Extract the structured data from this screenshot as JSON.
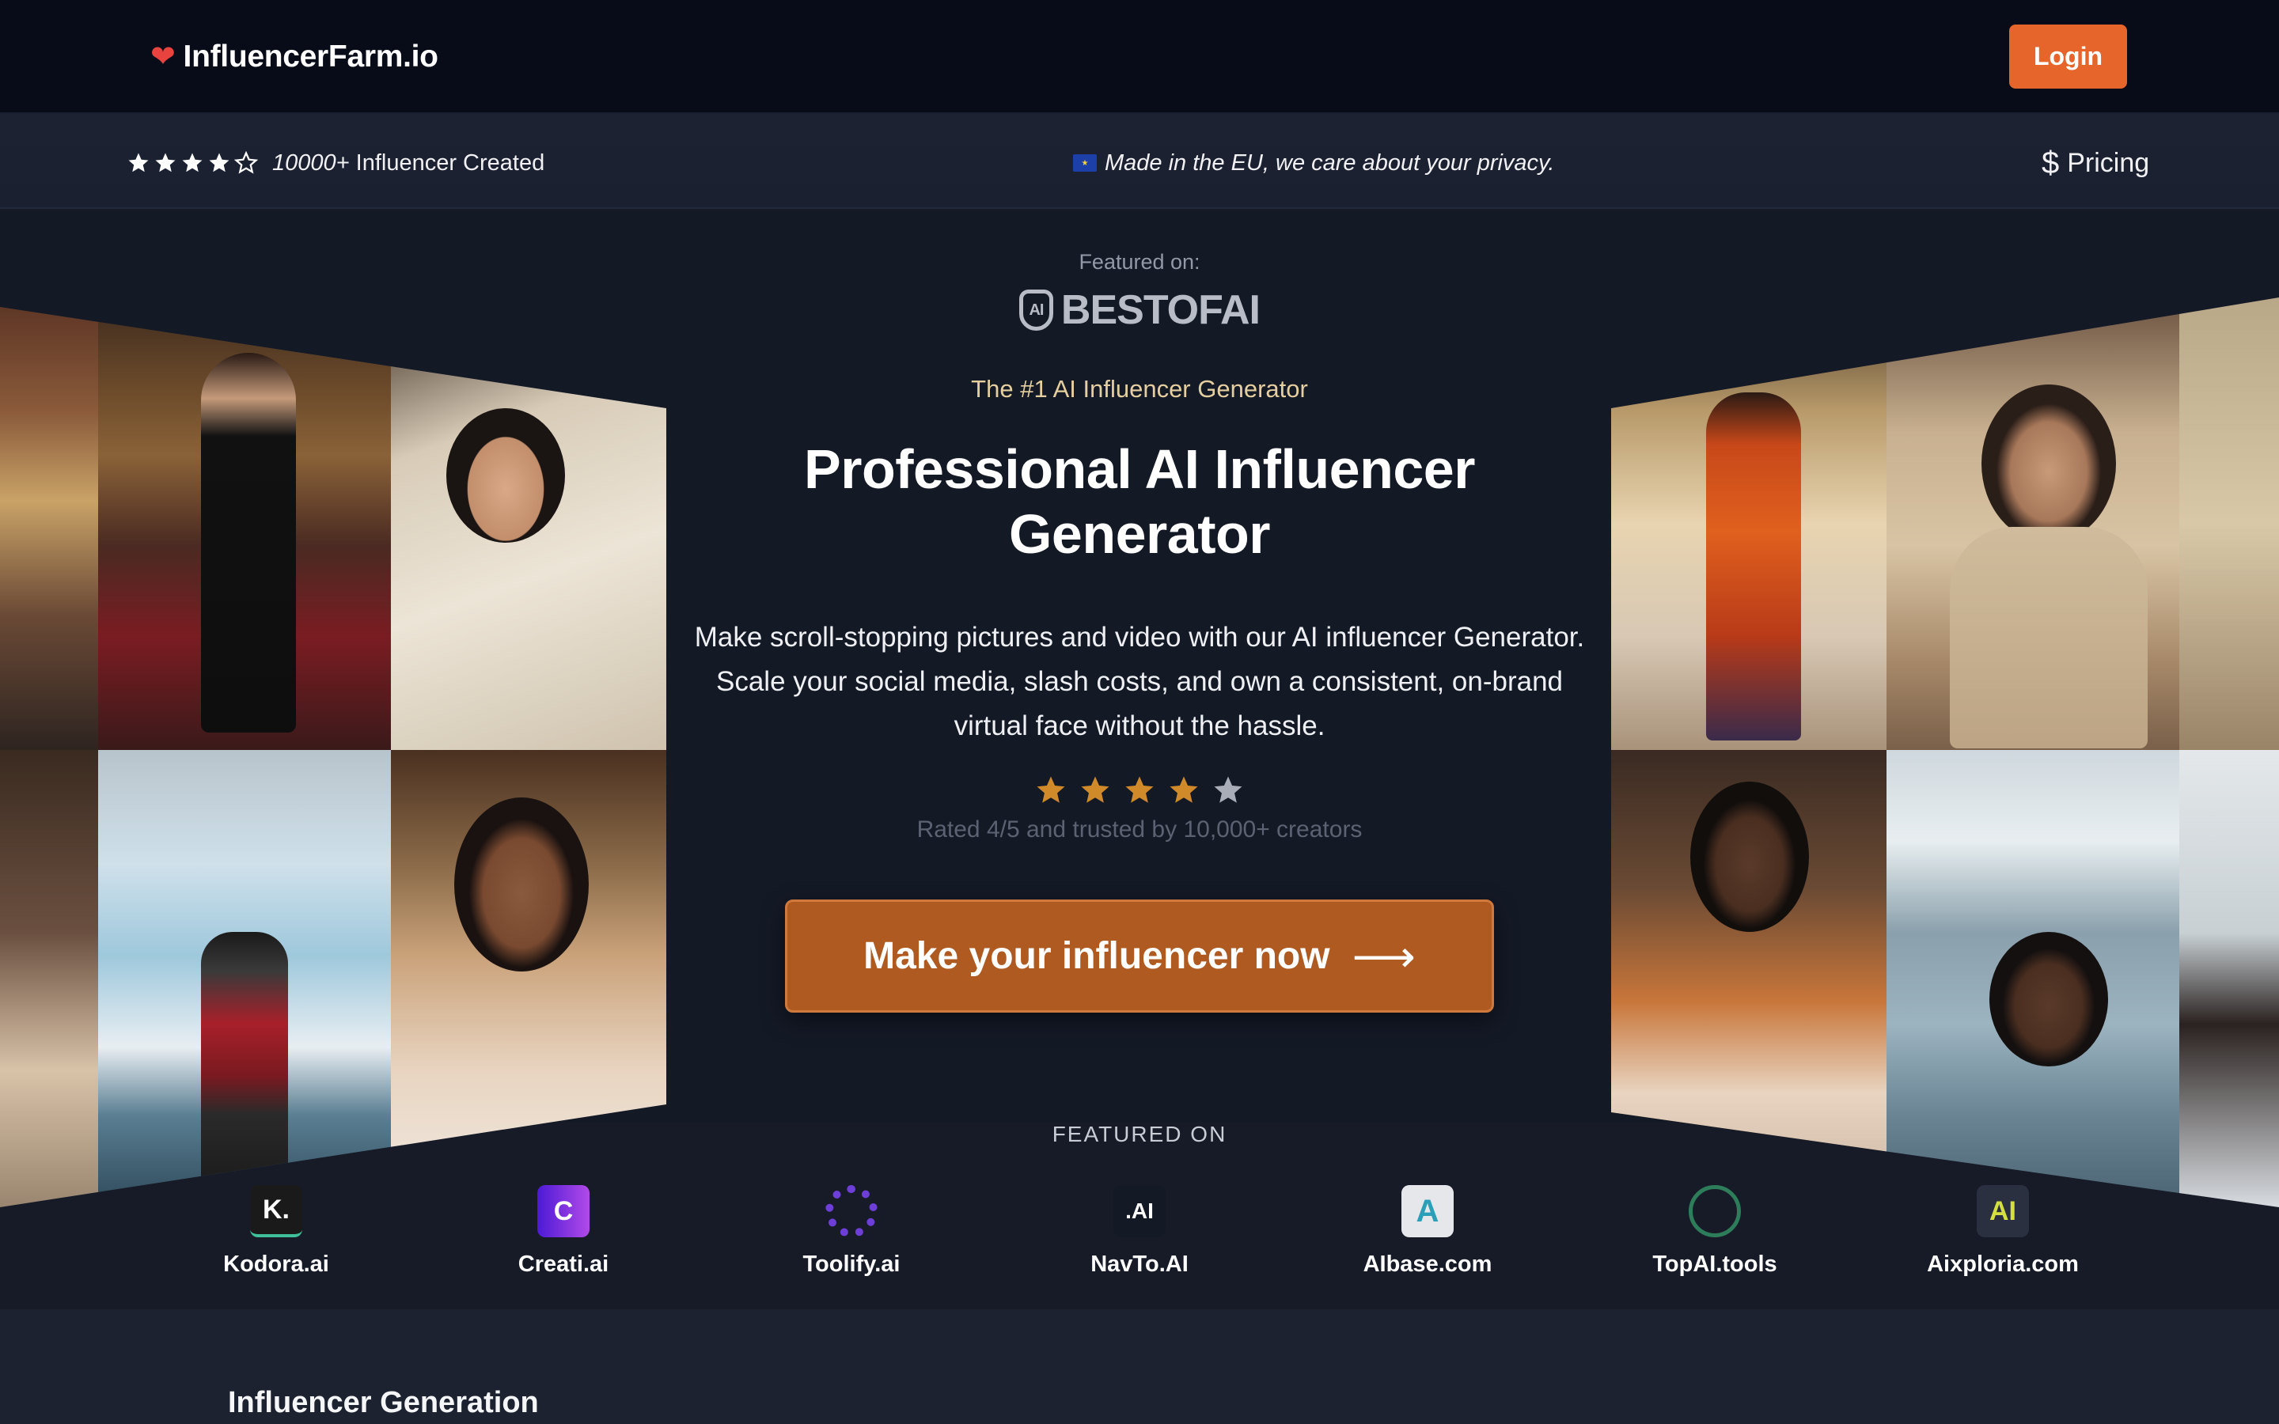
{
  "header": {
    "brand": "InfluencerFarm.io",
    "brand_icon": "heart-icon",
    "login_label": "Login"
  },
  "infobar": {
    "rating_stars": 4,
    "rating_max": 5,
    "created_count": "10000+",
    "created_suffix": " Influencer Created",
    "eu_note": "Made in the EU, we care about your privacy.",
    "pricing_label": "Pricing"
  },
  "hero": {
    "featured_small": "Featured on:",
    "bestofai": "BESTOFAI",
    "tagline": "The #1 AI Influencer Generator",
    "headline_line1": "Professional AI Influencer",
    "headline_line2": "Generator",
    "description": "Make scroll-stopping pictures and video with our AI influencer Generator. Scale your social media, slash costs, and own a consistent, on-brand virtual face without the hassle.",
    "rating_stars": 4,
    "rating_max": 5,
    "rated_text": "Rated 4/5 and trusted by 10,000+ creators",
    "cta_label": "Make your influencer now"
  },
  "featured": {
    "heading": "FEATURED ON",
    "logos": [
      {
        "name": "Kodora.ai",
        "mark": "K.",
        "color": "#1a1a1a"
      },
      {
        "name": "Creati.ai",
        "mark": "C",
        "color": "#6d28d9"
      },
      {
        "name": "Toolify.ai",
        "mark": "",
        "color": "#5b21b6"
      },
      {
        "name": "NavTo.AI",
        "mark": ".AI",
        "color": "#141926"
      },
      {
        "name": "AIbase.com",
        "mark": "A",
        "color": "#e5e7eb"
      },
      {
        "name": "TopAI.tools",
        "mark": "",
        "color": "#141926"
      },
      {
        "name": "Aixploria.com",
        "mark": "AI",
        "color": "#2a3040"
      }
    ]
  },
  "next_section": {
    "title": "Influencer Generation"
  },
  "colors": {
    "accent": "#e5652b",
    "cta": "#ae5a21",
    "star": "#d08a2a",
    "nav_bg": "#080c19"
  }
}
